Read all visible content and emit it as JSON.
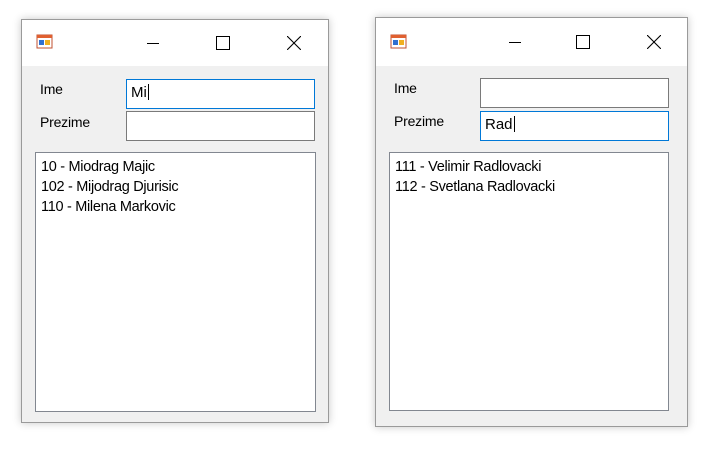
{
  "windows": [
    {
      "ime_label": "Ime",
      "prezime_label": "Prezime",
      "ime_value": "Mi",
      "prezime_value": "",
      "focused_field": "ime",
      "list_items": [
        "10 - Miodrag Majic",
        "102 - Mijodrag Djurisic",
        "110 - Milena Markovic"
      ]
    },
    {
      "ime_label": "Ime",
      "prezime_label": "Prezime",
      "ime_value": "",
      "prezime_value": "Rad",
      "focused_field": "prezime",
      "list_items": [
        "111 - Velimir Radlovacki",
        "112 - Svetlana Radlovacki"
      ]
    }
  ],
  "colors": {
    "focus_border": "#0078d7",
    "window_bg": "#f0f0f0",
    "titlebar_bg": "#ffffff"
  },
  "icons": [
    "app-icon",
    "minimize-icon",
    "maximize-icon",
    "close-icon"
  ]
}
